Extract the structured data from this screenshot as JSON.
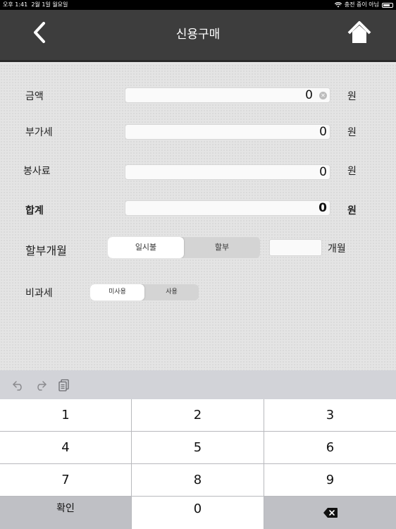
{
  "status_bar": {
    "time": "오후 1:41",
    "date": "2월 1일 월요일",
    "charging_text": "충전 중이 아님"
  },
  "nav": {
    "title": "신용구매"
  },
  "form": {
    "amount": {
      "label": "금액",
      "value": "0",
      "unit": "원"
    },
    "vat": {
      "label": "부가세",
      "value": "0",
      "unit": "원"
    },
    "service_fee": {
      "label": "봉사료",
      "value": "0",
      "unit": "원"
    },
    "total": {
      "label": "합계",
      "value": "0",
      "unit": "원"
    },
    "installment": {
      "label": "할부개월",
      "options": [
        "일시불",
        "할부"
      ],
      "selected": "일시불",
      "months_value": "",
      "months_unit": "개월"
    },
    "tax_free": {
      "label": "비과세",
      "options": [
        "미사용",
        "사용"
      ],
      "selected": "미사용"
    }
  },
  "keyboard": {
    "toolbar_icons": [
      "undo-icon",
      "redo-icon",
      "paste-icon"
    ],
    "keys": {
      "k1": "1",
      "k2": "2",
      "k3": "3",
      "k4": "4",
      "k5": "5",
      "k6": "6",
      "k7": "7",
      "k8": "8",
      "k9": "9",
      "confirm": "확인",
      "k0": "0"
    },
    "delete_icon": "backspace-icon"
  },
  "colors": {
    "navbar": "#3d3d3d",
    "background": "#e4e4e4",
    "keypad_dark": "#bfc0c5"
  }
}
